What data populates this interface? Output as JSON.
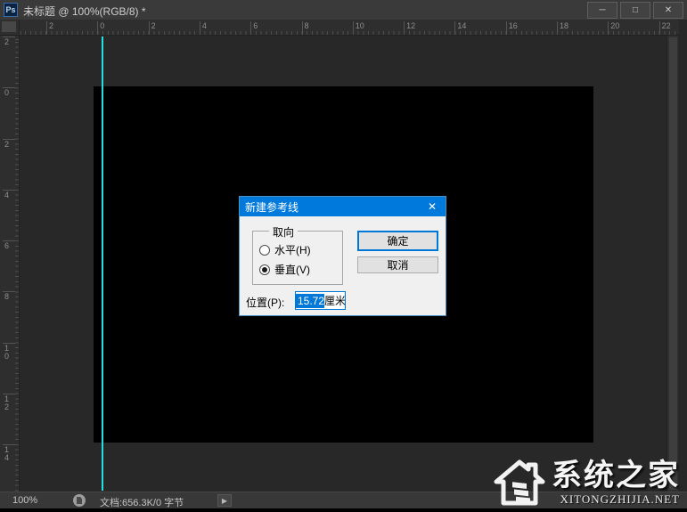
{
  "window": {
    "title": "未标题 @ 100%(RGB/8) *",
    "app_icon_label": "Ps",
    "controls": {
      "minimize_icon": "─",
      "maximize_icon": "□",
      "close_icon": "✕"
    }
  },
  "rulers": {
    "top_labels": [
      "2",
      "0",
      "2",
      "4",
      "6",
      "8",
      "10",
      "12",
      "14",
      "16",
      "18",
      "20",
      "22"
    ],
    "left_labels": [
      "2",
      "0",
      "2",
      "4",
      "6",
      "8",
      "10",
      "12",
      "14"
    ]
  },
  "dialog": {
    "title": "新建参考线",
    "close_icon": "✕",
    "orientation_group": {
      "legend": "取向",
      "options": [
        {
          "label": "水平(H)",
          "selected": false
        },
        {
          "label": "垂直(V)",
          "selected": true
        }
      ]
    },
    "position_label": "位置(P):",
    "position_value": "15.72",
    "position_unit": "厘米",
    "buttons": {
      "ok": "确定",
      "cancel": "取消"
    }
  },
  "status_bar": {
    "zoom": "100%",
    "document_info": "文档:656.3K/0 字节",
    "expand_icon": "▶"
  },
  "watermark": {
    "name": "系统之家",
    "url": "XITONGZHIJIA.NET"
  },
  "colors": {
    "accent_blue": "#0078d7",
    "dialog_titlebar": "#0079dc",
    "guide_cyan": "#1fe3e3",
    "canvas_black": "#000000",
    "chrome_dark": "#3a3a3a"
  }
}
